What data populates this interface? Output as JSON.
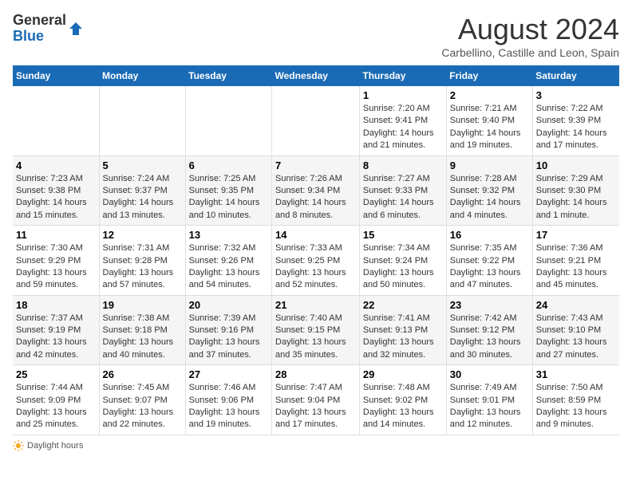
{
  "logo": {
    "general": "General",
    "blue": "Blue"
  },
  "title": "August 2024",
  "location": "Carbellino, Castille and Leon, Spain",
  "days_of_week": [
    "Sunday",
    "Monday",
    "Tuesday",
    "Wednesday",
    "Thursday",
    "Friday",
    "Saturday"
  ],
  "weeks": [
    [
      {
        "day": "",
        "info": ""
      },
      {
        "day": "",
        "info": ""
      },
      {
        "day": "",
        "info": ""
      },
      {
        "day": "",
        "info": ""
      },
      {
        "day": "1",
        "sunrise": "Sunrise: 7:20 AM",
        "sunset": "Sunset: 9:41 PM",
        "daylight": "Daylight: 14 hours and 21 minutes."
      },
      {
        "day": "2",
        "sunrise": "Sunrise: 7:21 AM",
        "sunset": "Sunset: 9:40 PM",
        "daylight": "Daylight: 14 hours and 19 minutes."
      },
      {
        "day": "3",
        "sunrise": "Sunrise: 7:22 AM",
        "sunset": "Sunset: 9:39 PM",
        "daylight": "Daylight: 14 hours and 17 minutes."
      }
    ],
    [
      {
        "day": "4",
        "sunrise": "Sunrise: 7:23 AM",
        "sunset": "Sunset: 9:38 PM",
        "daylight": "Daylight: 14 hours and 15 minutes."
      },
      {
        "day": "5",
        "sunrise": "Sunrise: 7:24 AM",
        "sunset": "Sunset: 9:37 PM",
        "daylight": "Daylight: 14 hours and 13 minutes."
      },
      {
        "day": "6",
        "sunrise": "Sunrise: 7:25 AM",
        "sunset": "Sunset: 9:35 PM",
        "daylight": "Daylight: 14 hours and 10 minutes."
      },
      {
        "day": "7",
        "sunrise": "Sunrise: 7:26 AM",
        "sunset": "Sunset: 9:34 PM",
        "daylight": "Daylight: 14 hours and 8 minutes."
      },
      {
        "day": "8",
        "sunrise": "Sunrise: 7:27 AM",
        "sunset": "Sunset: 9:33 PM",
        "daylight": "Daylight: 14 hours and 6 minutes."
      },
      {
        "day": "9",
        "sunrise": "Sunrise: 7:28 AM",
        "sunset": "Sunset: 9:32 PM",
        "daylight": "Daylight: 14 hours and 4 minutes."
      },
      {
        "day": "10",
        "sunrise": "Sunrise: 7:29 AM",
        "sunset": "Sunset: 9:30 PM",
        "daylight": "Daylight: 14 hours and 1 minute."
      }
    ],
    [
      {
        "day": "11",
        "sunrise": "Sunrise: 7:30 AM",
        "sunset": "Sunset: 9:29 PM",
        "daylight": "Daylight: 13 hours and 59 minutes."
      },
      {
        "day": "12",
        "sunrise": "Sunrise: 7:31 AM",
        "sunset": "Sunset: 9:28 PM",
        "daylight": "Daylight: 13 hours and 57 minutes."
      },
      {
        "day": "13",
        "sunrise": "Sunrise: 7:32 AM",
        "sunset": "Sunset: 9:26 PM",
        "daylight": "Daylight: 13 hours and 54 minutes."
      },
      {
        "day": "14",
        "sunrise": "Sunrise: 7:33 AM",
        "sunset": "Sunset: 9:25 PM",
        "daylight": "Daylight: 13 hours and 52 minutes."
      },
      {
        "day": "15",
        "sunrise": "Sunrise: 7:34 AM",
        "sunset": "Sunset: 9:24 PM",
        "daylight": "Daylight: 13 hours and 50 minutes."
      },
      {
        "day": "16",
        "sunrise": "Sunrise: 7:35 AM",
        "sunset": "Sunset: 9:22 PM",
        "daylight": "Daylight: 13 hours and 47 minutes."
      },
      {
        "day": "17",
        "sunrise": "Sunrise: 7:36 AM",
        "sunset": "Sunset: 9:21 PM",
        "daylight": "Daylight: 13 hours and 45 minutes."
      }
    ],
    [
      {
        "day": "18",
        "sunrise": "Sunrise: 7:37 AM",
        "sunset": "Sunset: 9:19 PM",
        "daylight": "Daylight: 13 hours and 42 minutes."
      },
      {
        "day": "19",
        "sunrise": "Sunrise: 7:38 AM",
        "sunset": "Sunset: 9:18 PM",
        "daylight": "Daylight: 13 hours and 40 minutes."
      },
      {
        "day": "20",
        "sunrise": "Sunrise: 7:39 AM",
        "sunset": "Sunset: 9:16 PM",
        "daylight": "Daylight: 13 hours and 37 minutes."
      },
      {
        "day": "21",
        "sunrise": "Sunrise: 7:40 AM",
        "sunset": "Sunset: 9:15 PM",
        "daylight": "Daylight: 13 hours and 35 minutes."
      },
      {
        "day": "22",
        "sunrise": "Sunrise: 7:41 AM",
        "sunset": "Sunset: 9:13 PM",
        "daylight": "Daylight: 13 hours and 32 minutes."
      },
      {
        "day": "23",
        "sunrise": "Sunrise: 7:42 AM",
        "sunset": "Sunset: 9:12 PM",
        "daylight": "Daylight: 13 hours and 30 minutes."
      },
      {
        "day": "24",
        "sunrise": "Sunrise: 7:43 AM",
        "sunset": "Sunset: 9:10 PM",
        "daylight": "Daylight: 13 hours and 27 minutes."
      }
    ],
    [
      {
        "day": "25",
        "sunrise": "Sunrise: 7:44 AM",
        "sunset": "Sunset: 9:09 PM",
        "daylight": "Daylight: 13 hours and 25 minutes."
      },
      {
        "day": "26",
        "sunrise": "Sunrise: 7:45 AM",
        "sunset": "Sunset: 9:07 PM",
        "daylight": "Daylight: 13 hours and 22 minutes."
      },
      {
        "day": "27",
        "sunrise": "Sunrise: 7:46 AM",
        "sunset": "Sunset: 9:06 PM",
        "daylight": "Daylight: 13 hours and 19 minutes."
      },
      {
        "day": "28",
        "sunrise": "Sunrise: 7:47 AM",
        "sunset": "Sunset: 9:04 PM",
        "daylight": "Daylight: 13 hours and 17 minutes."
      },
      {
        "day": "29",
        "sunrise": "Sunrise: 7:48 AM",
        "sunset": "Sunset: 9:02 PM",
        "daylight": "Daylight: 13 hours and 14 minutes."
      },
      {
        "day": "30",
        "sunrise": "Sunrise: 7:49 AM",
        "sunset": "Sunset: 9:01 PM",
        "daylight": "Daylight: 13 hours and 12 minutes."
      },
      {
        "day": "31",
        "sunrise": "Sunrise: 7:50 AM",
        "sunset": "Sunset: 8:59 PM",
        "daylight": "Daylight: 13 hours and 9 minutes."
      }
    ]
  ],
  "footer": {
    "daylight_label": "Daylight hours"
  }
}
